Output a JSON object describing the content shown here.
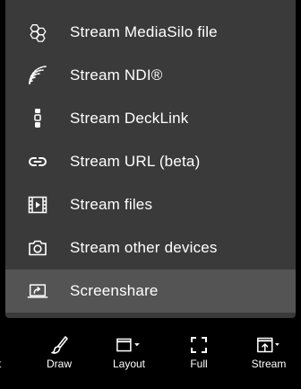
{
  "menu": {
    "items": [
      {
        "label": "Stream MediaSilo file",
        "icon": "mediasilo-icon"
      },
      {
        "label": "Stream NDI®",
        "icon": "ndi-icon"
      },
      {
        "label": "Stream DeckLink",
        "icon": "decklink-icon"
      },
      {
        "label": "Stream URL (beta)",
        "icon": "link-icon"
      },
      {
        "label": "Stream files",
        "icon": "film-icon"
      },
      {
        "label": "Stream other devices",
        "icon": "camera-icon"
      },
      {
        "label": "Screenshare",
        "icon": "screenshare-icon",
        "active": true
      }
    ]
  },
  "toolbar": {
    "partial_label": "t",
    "buttons": [
      {
        "label": "Draw",
        "icon": "brush-icon"
      },
      {
        "label": "Layout",
        "icon": "layout-icon"
      },
      {
        "label": "Full",
        "icon": "fullscreen-icon"
      },
      {
        "label": "Stream",
        "icon": "stream-upload-icon"
      }
    ]
  },
  "colors": {
    "background": "#000000",
    "menu_bg": "#3a3a3a",
    "active_bg": "#545454",
    "text": "#ffffff"
  }
}
